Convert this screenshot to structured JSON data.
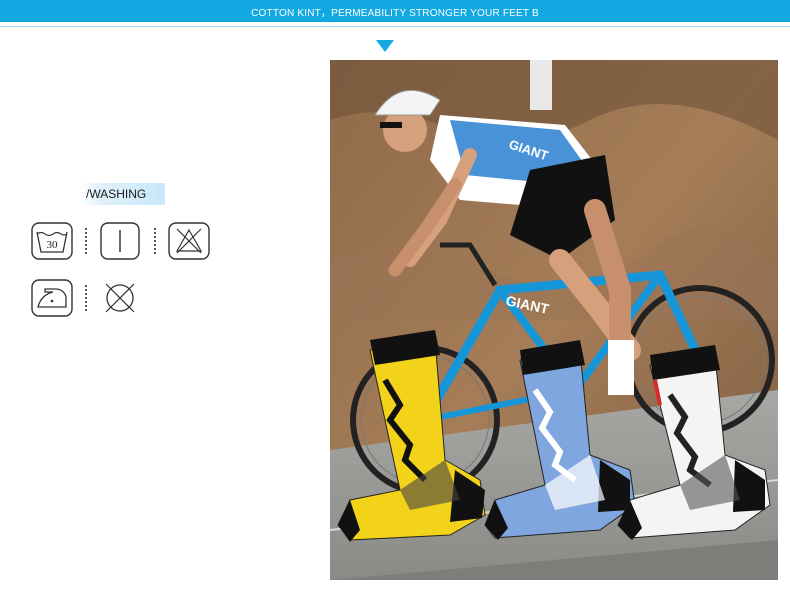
{
  "banner": {
    "text": "COTTON KINT，PERMEABILITY STRONGER YOUR FEET B"
  },
  "washing": {
    "label": "/WASHING",
    "wash_temperature": "30",
    "icons": [
      "wash-30-icon",
      "tumble-dry-icon",
      "no-bleach-icon",
      "iron-low-icon",
      "no-dry-clean-icon"
    ]
  },
  "photo": {
    "jersey_text": "GIANT",
    "bike_text": "GIANT",
    "sock_colors": [
      "#f3d31a",
      "#7fa6de",
      "#f4f4f4"
    ],
    "accent": "#12a9e3"
  }
}
